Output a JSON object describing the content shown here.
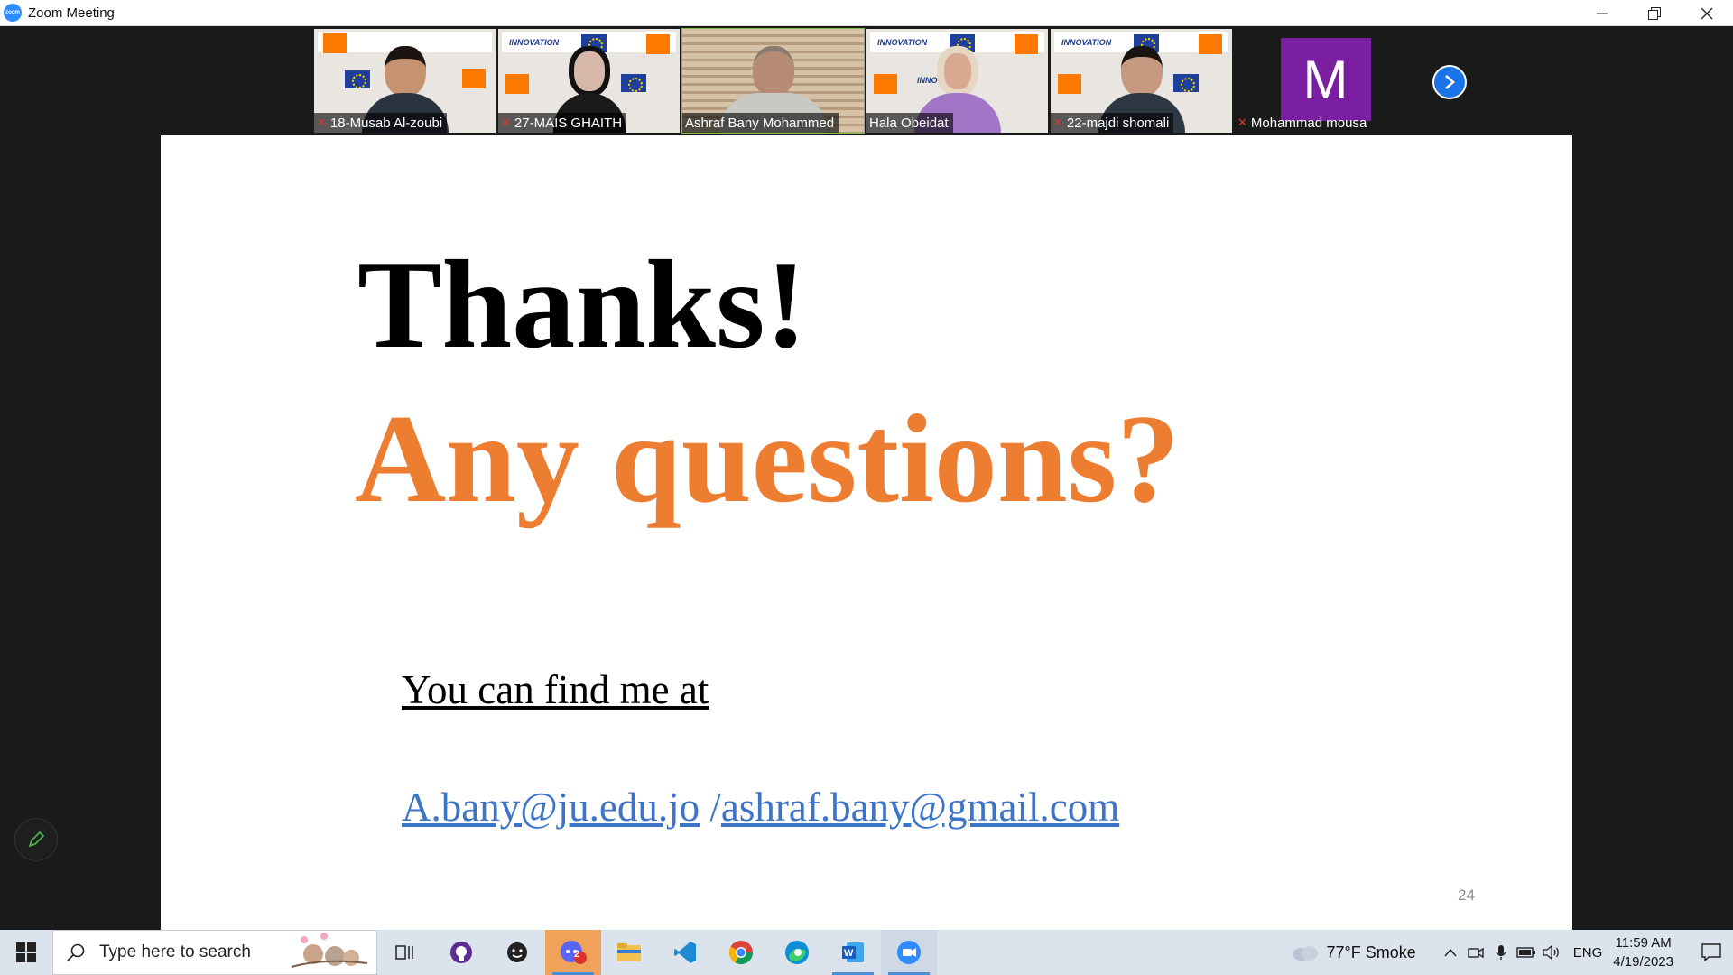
{
  "window": {
    "title": "Zoom Meeting",
    "app_icon_label": "zoom"
  },
  "participants": [
    {
      "name": "18-Musab Al-zoubi",
      "muted": true,
      "shirt": "#2a3340",
      "skin": "#c59272",
      "hair": "#1c1410"
    },
    {
      "name": "27-MAIS GHAITH",
      "muted": true,
      "shirt": "#1a1a1a",
      "skin": "#d7b8a8",
      "hair": "#111111"
    },
    {
      "name": "Ashraf Bany Mohammed",
      "muted": false,
      "active_speaker": true,
      "shirt": "#c9c9c4",
      "skin": "#b58b75",
      "hair": "#8c7b70"
    },
    {
      "name": "Hala Obeidat",
      "muted": false,
      "shirt": "#a276c7",
      "skin": "#d8a890",
      "hair": "#e6d6c4"
    },
    {
      "name": "22-majdi shomali",
      "muted": true,
      "shirt": "#2e3842",
      "skin": "#c69a80",
      "hair": "#1a1410"
    },
    {
      "name": "Mohammad mousa",
      "muted": true,
      "avatar_letter": "M",
      "avatar_color": "#7b1fa2"
    }
  ],
  "slide": {
    "title": "Thanks!",
    "subtitle": "Any questions?",
    "find_me": "You can find me at",
    "email_primary": "A.bany@ju.edu.jo",
    "separator": " /",
    "email_secondary": "ashraf.bany@gmail.com",
    "page_number": "24",
    "subtitle_color": "#ec7d31",
    "link_color": "#3e74c8"
  },
  "taskbar": {
    "search_placeholder": "Type here to search",
    "weather": "77°F  Smoke",
    "language": "ENG",
    "time": "11:59 AM",
    "date": "4/19/2023",
    "apps": [
      "task-view-icon",
      "github-icon",
      "emoji-icon",
      "discord-icon",
      "file-explorer-icon",
      "vscode-icon",
      "chrome-icon",
      "edge-icon",
      "word-icon",
      "zoom-icon"
    ],
    "discord_badge": "2"
  }
}
